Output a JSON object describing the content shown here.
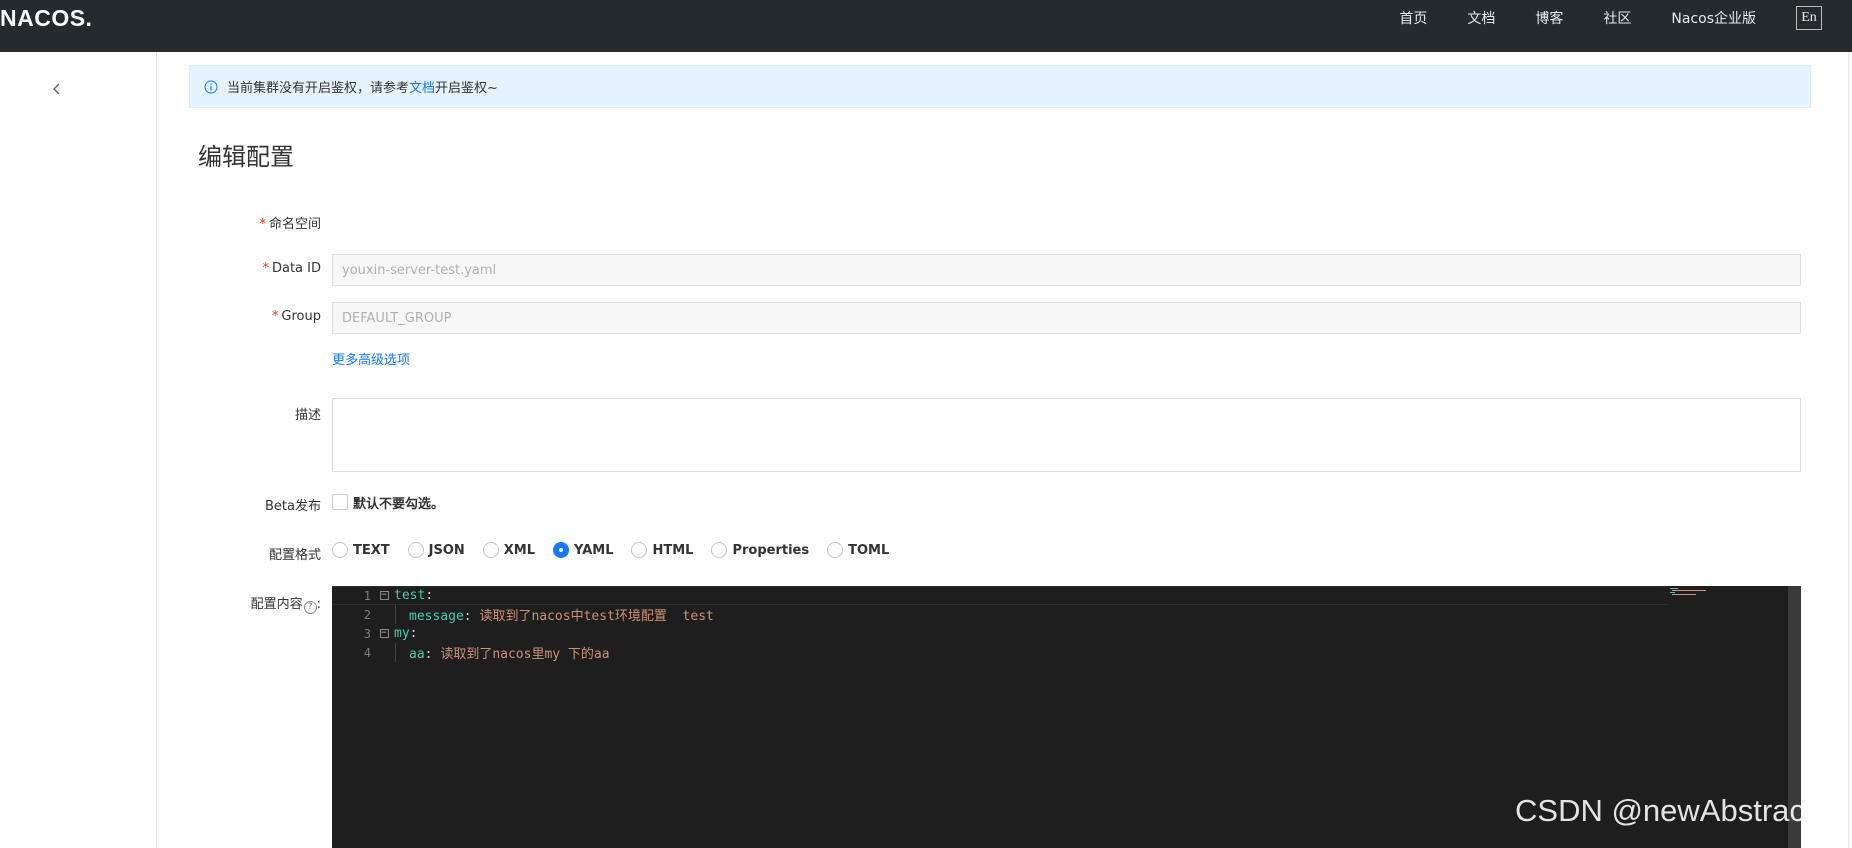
{
  "header": {
    "logo": "NACOS.",
    "nav": [
      "首页",
      "文档",
      "博客",
      "社区",
      "Nacos企业版"
    ],
    "lang": "En"
  },
  "notice": {
    "prefix": "当前集群没有开启鉴权，请参考",
    "link": "文档",
    "suffix": "开启鉴权~"
  },
  "page_title": "编辑配置",
  "form": {
    "namespace_label": "命名空间",
    "dataid_label": "Data ID",
    "dataid_value": "youxin-server-test.yaml",
    "group_label": "Group",
    "group_value": "DEFAULT_GROUP",
    "advanced_link": "更多高级选项",
    "desc_label": "描述",
    "beta_label": "Beta发布",
    "beta_checkbox_label": "默认不要勾选。",
    "format_label": "配置格式",
    "formats": [
      "TEXT",
      "JSON",
      "XML",
      "YAML",
      "HTML",
      "Properties",
      "TOML"
    ],
    "selected_format": "YAML",
    "content_label": "配置内容",
    "help_icon": "?",
    "required_mark": "*"
  },
  "editor": {
    "lines": [
      {
        "num": "1",
        "key": "test",
        "sep": ":",
        "value": "",
        "fold": true
      },
      {
        "num": "2",
        "key": "message",
        "sep": ": ",
        "value": "读取到了nacos中test环境配置  test",
        "fold": false
      },
      {
        "num": "3",
        "key": "my",
        "sep": ":",
        "value": "",
        "fold": true
      },
      {
        "num": "4",
        "key": "aa",
        "sep": ": ",
        "value": "读取到了nacos里my 下的aa",
        "fold": false
      }
    ]
  },
  "watermark": "CSDN @newAbstract",
  "colors": {
    "topbar": "#252a2f",
    "accent": "#1677ff",
    "notice_bg": "#e4f3fe",
    "editor_bg": "#1e1e1e",
    "yaml_key": "#4ec9b0",
    "yaml_value": "#ce9178"
  },
  "icons": {
    "collapse": "chevron-left-icon",
    "notice": "info-icon",
    "help": "question-circle-icon"
  }
}
